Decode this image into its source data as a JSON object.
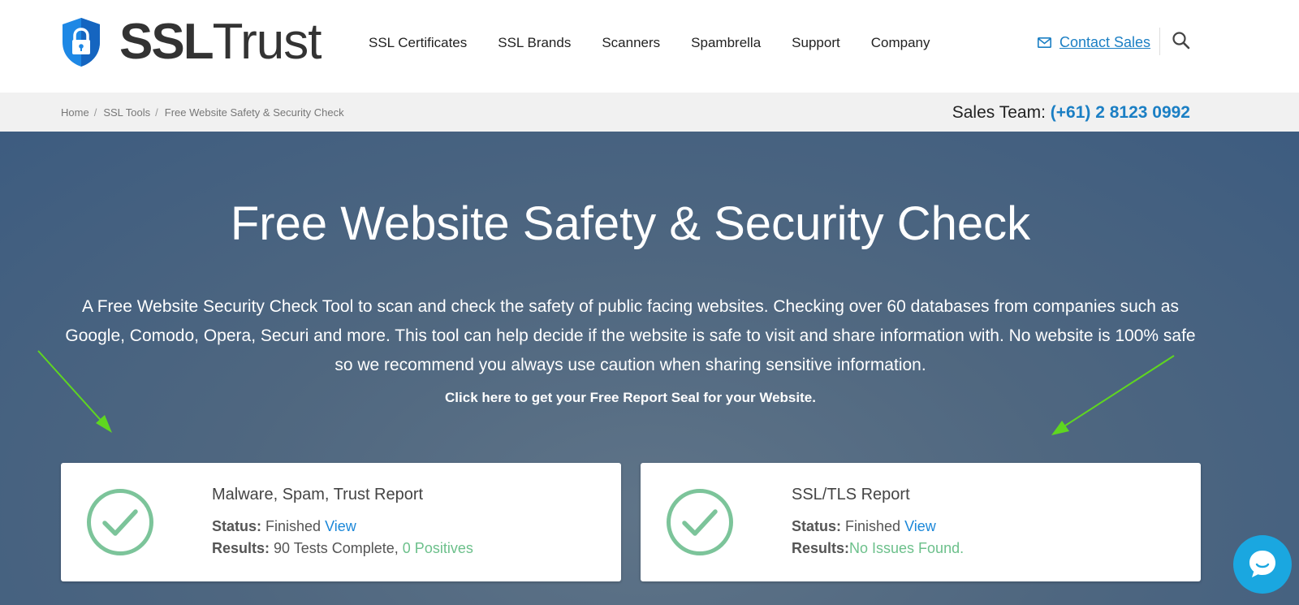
{
  "logo": {
    "ssl": "SSL",
    "trust": "Trust",
    "icon": "shield-lock-icon"
  },
  "nav": [
    {
      "label": "SSL Certificates"
    },
    {
      "label": "SSL Brands"
    },
    {
      "label": "Scanners"
    },
    {
      "label": "Spambrella"
    },
    {
      "label": "Support"
    },
    {
      "label": "Company"
    }
  ],
  "header": {
    "contact_label": "Contact Sales",
    "contact_icon": "envelope-icon",
    "search_icon": "search-icon"
  },
  "breadcrumb": [
    {
      "label": "Home"
    },
    {
      "label": "SSL Tools"
    },
    {
      "label": "Free Website Safety & Security Check"
    }
  ],
  "breadcrumb_sep": "/",
  "sales": {
    "label": "Sales Team:",
    "phone": "(+61) 2 8123 0992"
  },
  "hero": {
    "title": "Free Website Safety & Security Check",
    "description": "A Free Website Security Check Tool to scan and check the safety of public facing websites. Checking over 60 databases from companies such as Google, Comodo, Opera, Securi and more. This tool can help decide if the website is safe to visit and share information with. No website is 100% safe so we recommend you always use caution when sharing sensitive information.",
    "link": "Click here to get your Free Report Seal for your Website."
  },
  "cards": [
    {
      "title": "Malware, Spam, Trust Report",
      "status_label": "Status:",
      "status_value": "Finished",
      "view": "View",
      "results_label": "Results:",
      "results_value": "90 Tests Complete,",
      "results_highlight": "0 Positives",
      "icon": "check-circle-icon"
    },
    {
      "title": "SSL/TLS Report",
      "status_label": "Status:",
      "status_value": "Finished",
      "view": "View",
      "results_label": "Results:",
      "results_value": "",
      "results_highlight": "No Issues Found.",
      "icon": "check-circle-icon"
    }
  ],
  "chat": {
    "icon": "chat-bubble-icon"
  },
  "colors": {
    "brand_blue": "#1b7fc4",
    "success_green": "#6cc08b",
    "check_green": "#7cc49a",
    "arrow_green": "#5fd620",
    "chat_blue": "#1aa7e0"
  }
}
